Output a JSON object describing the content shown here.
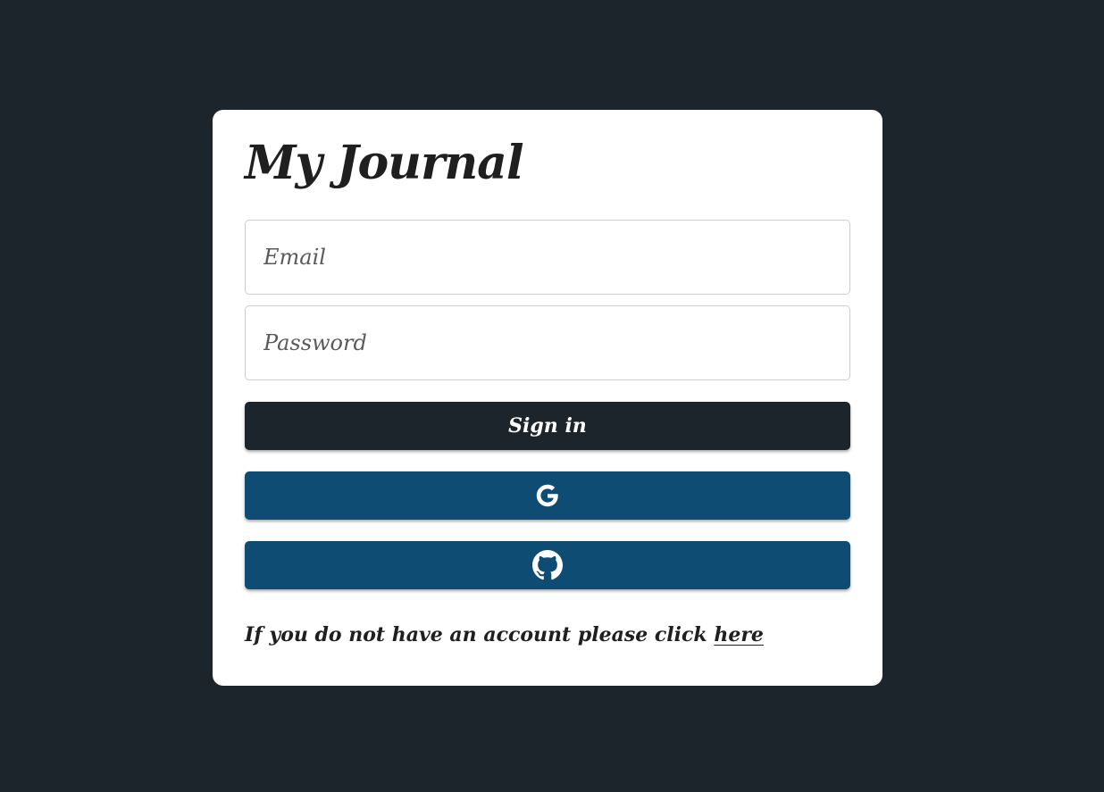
{
  "app": {
    "title": "My Journal"
  },
  "form": {
    "email": {
      "placeholder": "Email",
      "value": ""
    },
    "password": {
      "placeholder": "Password",
      "value": ""
    },
    "signin_label": "Sign in",
    "google_button_icon": "google-icon",
    "github_button_icon": "github-icon"
  },
  "footer": {
    "text": "If you do not have an account please click",
    "link_label": "here"
  },
  "colors": {
    "background": "#1c252c",
    "card": "#ffffff",
    "signin_button": "#1c252c",
    "social_button": "#0f4c73"
  }
}
